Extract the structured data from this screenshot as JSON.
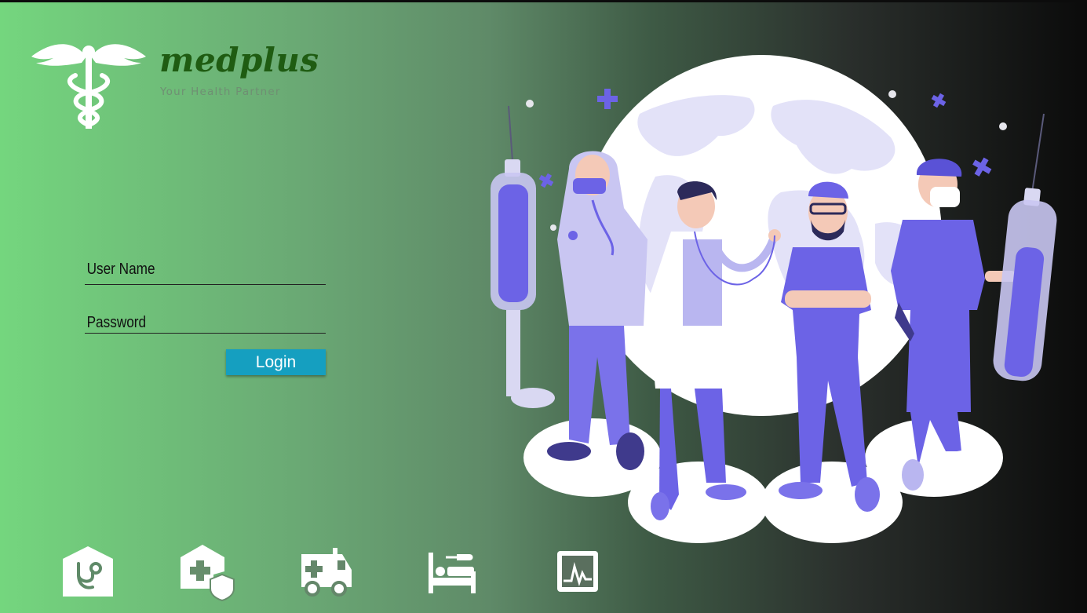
{
  "brand": {
    "name": "medplus",
    "tagline": "Your Health Partner"
  },
  "login_form": {
    "username_placeholder": "User Name",
    "password_placeholder": "Password",
    "login_label": "Login"
  },
  "colors": {
    "brand_green": "#1f5c12",
    "login_button": "#159fc0",
    "illustration_purple": "#6c63e6"
  },
  "bottom_icons": [
    "clinic-stethoscope-icon",
    "hospital-insurance-icon",
    "ambulance-icon",
    "hospital-bed-icon",
    "health-monitor-icon"
  ]
}
